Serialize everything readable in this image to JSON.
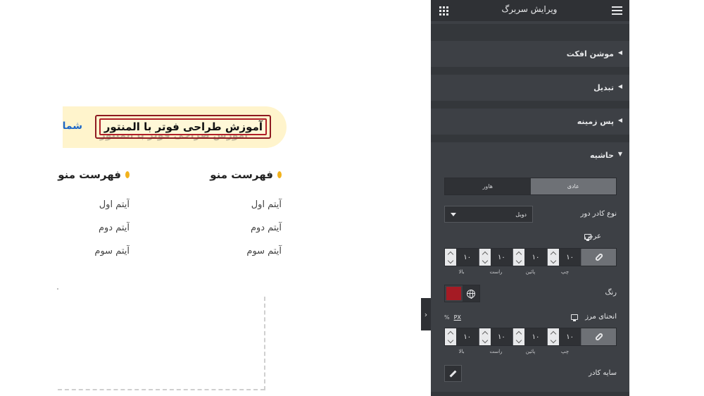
{
  "canvas": {
    "headline": "آموزش طراحی فوتر با المنتور",
    "headline_ghost": "آموزش طراحی فوتر با المنتور",
    "link_text": "شماره",
    "menu_columns": [
      {
        "heading": "فهرست منو",
        "items": [
          "آیتم اول",
          "آیتم دوم",
          "آیتم سوم"
        ]
      },
      {
        "heading": "فهرست منو",
        "items": [
          "آیتم اول",
          "آیتم دوم",
          "آیتم سوم"
        ]
      }
    ],
    "accent_color": "#f2b21c"
  },
  "panel": {
    "title": "ویرایش سربرگ",
    "menu_icon": "hamburger-icon",
    "apps_icon": "grid-icon",
    "sections": [
      {
        "label": "موشن افکت",
        "state": "collapsed"
      },
      {
        "label": "تبدیل",
        "state": "collapsed"
      },
      {
        "label": "پس زمینه",
        "state": "collapsed"
      },
      {
        "label": "حاشیه",
        "state": "expanded"
      }
    ],
    "tabs": {
      "normal": "عادی",
      "hover": "هاور"
    },
    "border_type": {
      "label": "نوع کادر دور",
      "value": "دوبل"
    },
    "width": {
      "label": "عرض",
      "values": [
        "۱۰",
        "۱۰",
        "۱۰",
        "۱۰"
      ],
      "sides": [
        "بالا",
        "راست",
        "پائین",
        "چپ"
      ]
    },
    "color": {
      "label": "رنگ",
      "value": "#a51b24"
    },
    "radius": {
      "label": "انحنای مرز",
      "units": [
        "%",
        "PX"
      ],
      "active_unit": "PX",
      "values": [
        "۱۰",
        "۱۰",
        "۱۰",
        "۱۰"
      ],
      "sides": [
        "بالا",
        "راست",
        "پائین",
        "چپ"
      ]
    },
    "box_shadow": {
      "label": "سایه کادر"
    }
  }
}
